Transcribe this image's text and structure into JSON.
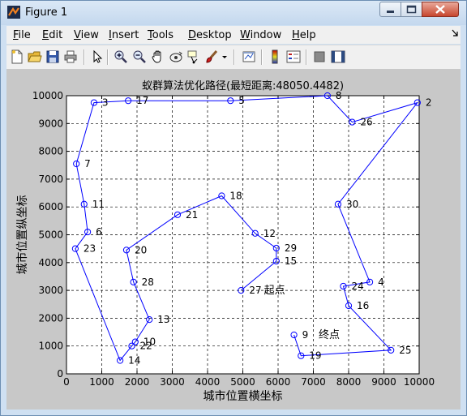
{
  "window": {
    "title": "Figure 1"
  },
  "menu": {
    "items": [
      "File",
      "Edit",
      "View",
      "Insert",
      "Tools",
      "Desktop",
      "Window",
      "Help"
    ],
    "underline": [
      "F",
      "E",
      "V",
      "I",
      "T",
      "D",
      "W",
      "H"
    ]
  },
  "toolbar": {
    "icons": [
      "new-figure-icon",
      "open-file-icon",
      "save-icon",
      "print-icon",
      "edit-plot-arrow-icon",
      "zoom-in-icon",
      "zoom-out-icon",
      "pan-hand-icon",
      "rotate-3d-icon",
      "data-cursor-icon",
      "brush-icon",
      "link-plot-icon",
      "colorbar-icon",
      "legend-icon",
      "hide-plot-tools-icon",
      "show-plot-tools-icon"
    ]
  },
  "chart_data": {
    "type": "line",
    "title": "蚁群算法优化路径(最短距离:48050.4482)",
    "xlabel": "城市位置横坐标",
    "ylabel": "城市位置纵坐标",
    "xlim": [
      0,
      10000
    ],
    "ylim": [
      0,
      10000
    ],
    "xticks": [
      0,
      1000,
      2000,
      3000,
      4000,
      5000,
      6000,
      7000,
      8000,
      9000,
      10000
    ],
    "yticks": [
      0,
      1000,
      2000,
      3000,
      4000,
      5000,
      6000,
      7000,
      8000,
      9000,
      10000
    ],
    "grid": true,
    "marker": "circle",
    "color": "#0000ff",
    "cities": [
      {
        "id": 27,
        "x": 4950,
        "y": 3000,
        "label": "27"
      },
      {
        "id": 15,
        "x": 5950,
        "y": 4050,
        "label": "15"
      },
      {
        "id": 29,
        "x": 5950,
        "y": 4520,
        "label": "29"
      },
      {
        "id": 12,
        "x": 5350,
        "y": 5050,
        "label": "12"
      },
      {
        "id": 18,
        "x": 4400,
        "y": 6400,
        "label": "18"
      },
      {
        "id": 21,
        "x": 3150,
        "y": 5720,
        "label": "21"
      },
      {
        "id": 20,
        "x": 1700,
        "y": 4450,
        "label": "20"
      },
      {
        "id": 28,
        "x": 1900,
        "y": 3300,
        "label": "28"
      },
      {
        "id": 13,
        "x": 2350,
        "y": 1950,
        "label": "13"
      },
      {
        "id": 10,
        "x": 1950,
        "y": 1150,
        "label": "10"
      },
      {
        "id": 22,
        "x": 1850,
        "y": 1000,
        "label": "22"
      },
      {
        "id": 14,
        "x": 1520,
        "y": 480,
        "label": "14"
      },
      {
        "id": 23,
        "x": 250,
        "y": 4500,
        "label": "23"
      },
      {
        "id": 6,
        "x": 600,
        "y": 5100,
        "label": "6"
      },
      {
        "id": 11,
        "x": 500,
        "y": 6100,
        "label": "11"
      },
      {
        "id": 7,
        "x": 280,
        "y": 7550,
        "label": "7"
      },
      {
        "id": 3,
        "x": 780,
        "y": 9750,
        "label": "3"
      },
      {
        "id": 17,
        "x": 1750,
        "y": 9820,
        "label": "17"
      },
      {
        "id": 5,
        "x": 4650,
        "y": 9820,
        "label": "5"
      },
      {
        "id": 8,
        "x": 7400,
        "y": 10000,
        "label": "8"
      },
      {
        "id": 26,
        "x": 8100,
        "y": 9050,
        "label": "26"
      },
      {
        "id": 2,
        "x": 9950,
        "y": 9750,
        "label": "2"
      },
      {
        "id": 30,
        "x": 7700,
        "y": 6100,
        "label": "30"
      },
      {
        "id": 4,
        "x": 8600,
        "y": 3300,
        "label": "4"
      },
      {
        "id": 24,
        "x": 7850,
        "y": 3150,
        "label": "24"
      },
      {
        "id": 16,
        "x": 8000,
        "y": 2450,
        "label": "16"
      },
      {
        "id": 25,
        "x": 9200,
        "y": 850,
        "label": "25"
      },
      {
        "id": 19,
        "x": 6650,
        "y": 650,
        "label": "19"
      },
      {
        "id": 9,
        "x": 6450,
        "y": 1400,
        "label": "9"
      }
    ],
    "annotations": [
      {
        "text": "起点",
        "x": 5600,
        "y": 3000
      },
      {
        "text": "终点",
        "x": 7150,
        "y": 1400
      }
    ]
  }
}
